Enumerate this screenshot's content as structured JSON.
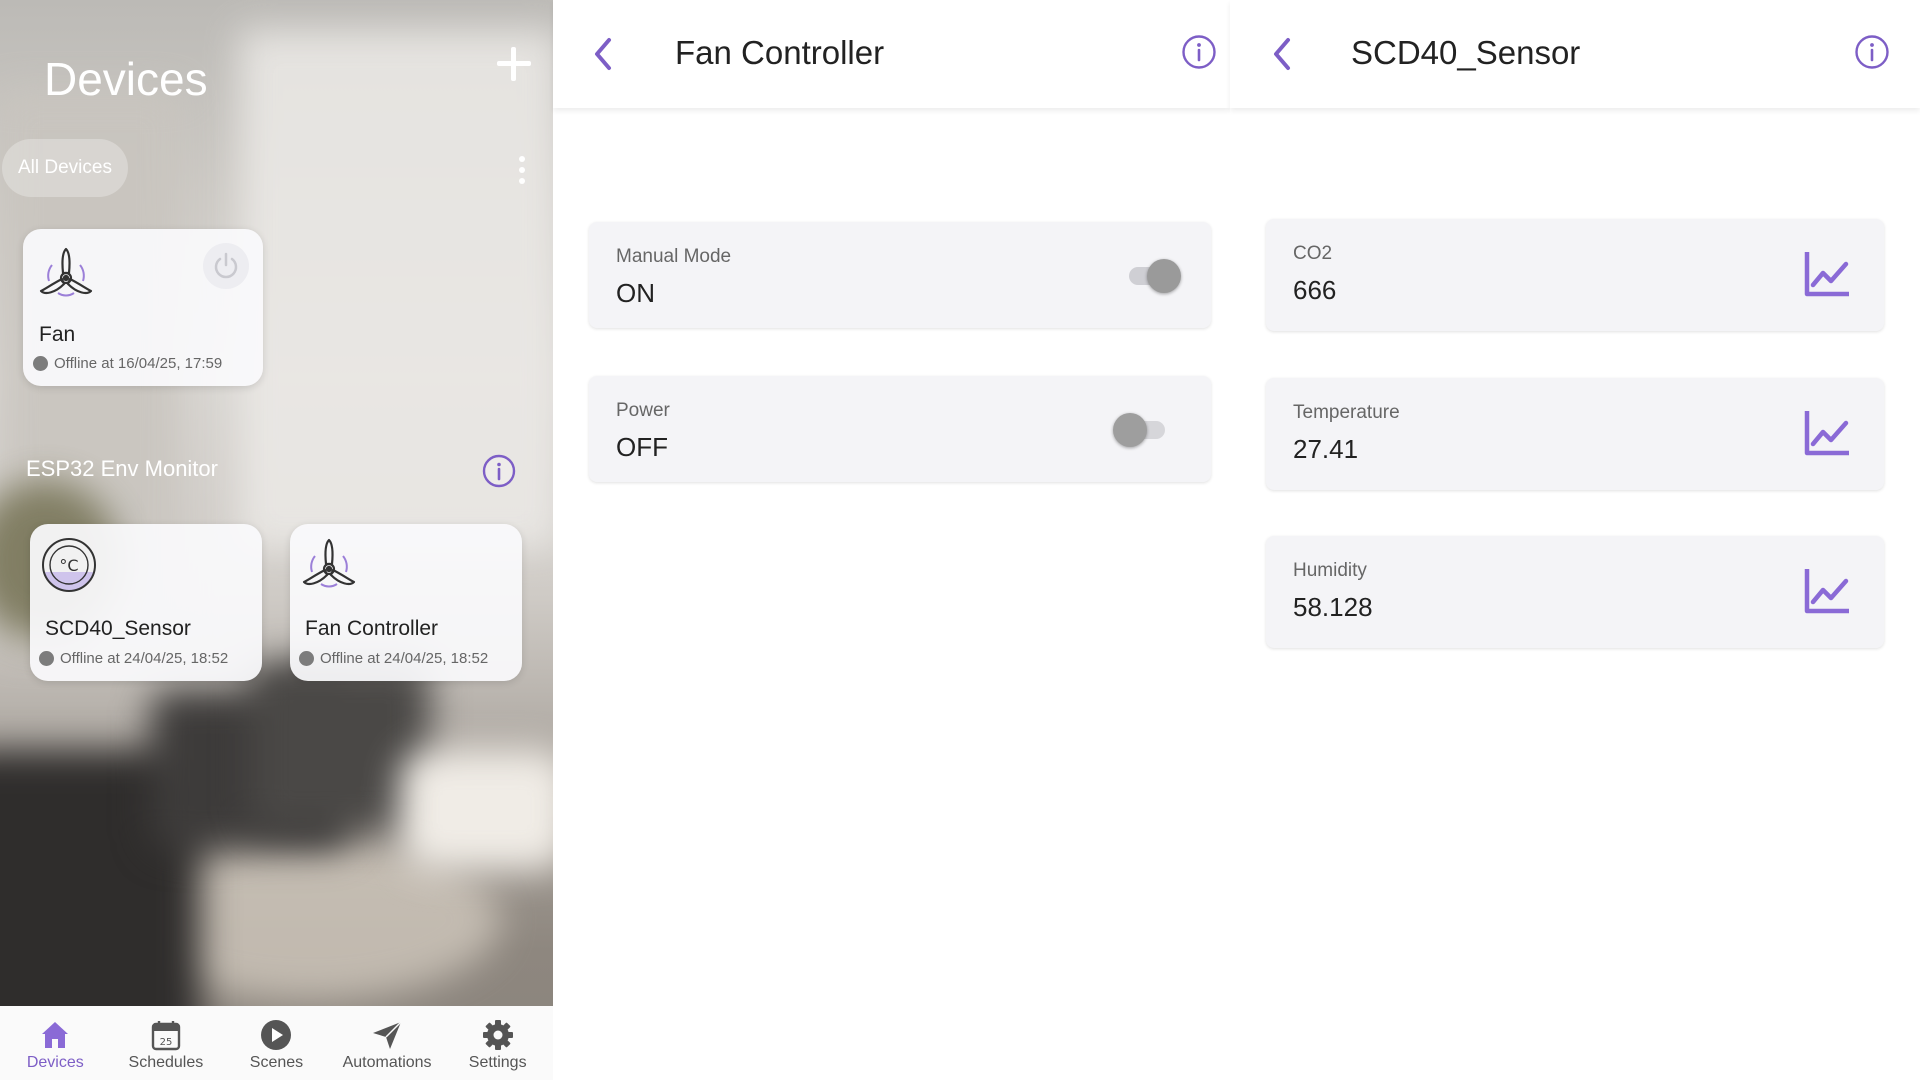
{
  "colors": {
    "accent": "#7d5ec6",
    "offline_dot": "#7c7c7c"
  },
  "devices_panel": {
    "title": "Devices",
    "add_icon": "plus-icon",
    "filter_chip": "All Devices",
    "menu_icon": "kebab-menu-icon",
    "ungrouped": [
      {
        "name": "Fan",
        "status": "Offline at 16/04/25, 17:59",
        "icon": "fan-icon",
        "power_icon": "power-icon"
      }
    ],
    "group": {
      "label": "ESP32 Env Monitor",
      "info_icon": "info-icon",
      "devices": [
        {
          "name": "SCD40_Sensor",
          "status": "Offline at 24/04/25, 18:52",
          "icon": "temperature-sensor-icon"
        },
        {
          "name": "Fan Controller",
          "status": "Offline at 24/04/25, 18:52",
          "icon": "fan-icon"
        }
      ]
    },
    "bottom_nav": [
      {
        "label": "Devices",
        "icon": "home-icon",
        "active": true
      },
      {
        "label": "Schedules",
        "icon": "calendar-icon",
        "calendar_day": "25",
        "active": false
      },
      {
        "label": "Scenes",
        "icon": "play-icon",
        "active": false
      },
      {
        "label": "Automations",
        "icon": "send-icon",
        "active": false
      },
      {
        "label": "Settings",
        "icon": "gear-icon",
        "active": false
      }
    ]
  },
  "fan_controller": {
    "title": "Fan Controller",
    "back_icon": "chevron-left-icon",
    "info_icon": "info-icon",
    "params": [
      {
        "label": "Manual Mode",
        "value": "ON",
        "toggle": true
      },
      {
        "label": "Power",
        "value": "OFF",
        "toggle": false
      }
    ]
  },
  "sensor": {
    "title": "SCD40_Sensor",
    "back_icon": "chevron-left-icon",
    "info_icon": "info-icon",
    "params": [
      {
        "label": "CO2",
        "value": "666",
        "icon": "chart-icon"
      },
      {
        "label": "Temperature",
        "value": "27.41",
        "icon": "chart-icon"
      },
      {
        "label": "Humidity",
        "value": "58.128",
        "icon": "chart-icon"
      }
    ]
  }
}
